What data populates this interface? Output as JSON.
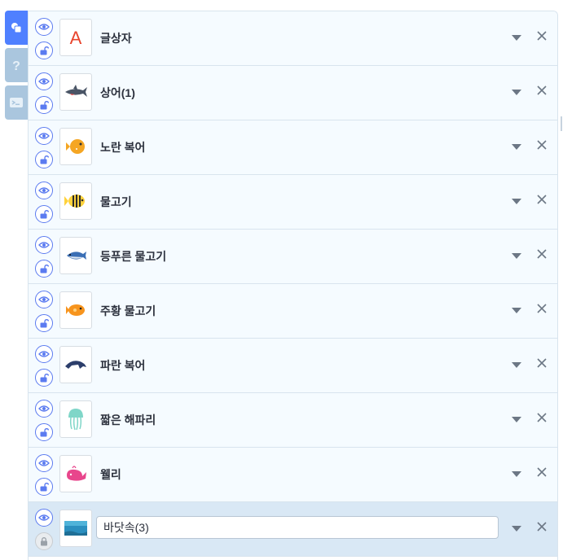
{
  "sidebar_tabs": [
    {
      "name": "objects-tab",
      "icon": "shapes-icon",
      "active": true
    },
    {
      "name": "help-tab",
      "icon": "question-icon",
      "active": false
    },
    {
      "name": "console-tab",
      "icon": "console-icon",
      "active": false
    }
  ],
  "objects": [
    {
      "label": "글상자",
      "thumb": "text-box-icon",
      "locked": false,
      "selected": false,
      "editing": false
    },
    {
      "label": "상어(1)",
      "thumb": "shark-icon",
      "locked": false,
      "selected": false,
      "editing": false
    },
    {
      "label": "노란 복어",
      "thumb": "yellow-pufferfish-icon",
      "locked": false,
      "selected": false,
      "editing": false
    },
    {
      "label": "물고기",
      "thumb": "fish-icon",
      "locked": false,
      "selected": false,
      "editing": false
    },
    {
      "label": "등푸른 물고기",
      "thumb": "blue-back-fish-icon",
      "locked": false,
      "selected": false,
      "editing": false
    },
    {
      "label": "주황 물고기",
      "thumb": "orange-fish-icon",
      "locked": false,
      "selected": false,
      "editing": false
    },
    {
      "label": "파란 복어",
      "thumb": "blue-pufferfish-icon",
      "locked": false,
      "selected": false,
      "editing": false
    },
    {
      "label": "짧은 해파리",
      "thumb": "jellyfish-icon",
      "locked": false,
      "selected": false,
      "editing": false
    },
    {
      "label": "웰리",
      "thumb": "whale-icon",
      "locked": false,
      "selected": false,
      "editing": false
    },
    {
      "label": "바닷속(3)",
      "thumb": "seabed-icon",
      "locked": true,
      "selected": true,
      "editing": true
    }
  ],
  "colors": {
    "accent": "#4f80ff",
    "row_bg": "#f5fbff",
    "selected_bg": "#d9e8f5",
    "text": "#2c313d"
  }
}
